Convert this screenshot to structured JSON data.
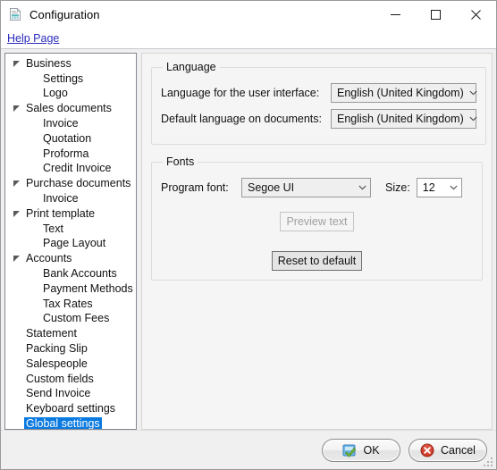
{
  "window": {
    "title": "Configuration",
    "icon": "document-icon",
    "minimize_label": "Minimize",
    "maximize_label": "Maximize",
    "close_label": "Close"
  },
  "menu": {
    "help_link": "Help Page"
  },
  "tree": {
    "selected": "Global settings",
    "items": [
      {
        "label": "Business",
        "level": 0,
        "expandable": true,
        "selected": false
      },
      {
        "label": "Settings",
        "level": 1,
        "expandable": false,
        "selected": false
      },
      {
        "label": "Logo",
        "level": 1,
        "expandable": false,
        "selected": false
      },
      {
        "label": "Sales documents",
        "level": 0,
        "expandable": true,
        "selected": false
      },
      {
        "label": "Invoice",
        "level": 1,
        "expandable": false,
        "selected": false
      },
      {
        "label": "Quotation",
        "level": 1,
        "expandable": false,
        "selected": false
      },
      {
        "label": "Proforma",
        "level": 1,
        "expandable": false,
        "selected": false
      },
      {
        "label": "Credit Invoice",
        "level": 1,
        "expandable": false,
        "selected": false
      },
      {
        "label": "Purchase documents",
        "level": 0,
        "expandable": true,
        "selected": false
      },
      {
        "label": "Invoice",
        "level": 1,
        "expandable": false,
        "selected": false
      },
      {
        "label": "Print template",
        "level": 0,
        "expandable": true,
        "selected": false
      },
      {
        "label": "Text",
        "level": 1,
        "expandable": false,
        "selected": false
      },
      {
        "label": "Page Layout",
        "level": 1,
        "expandable": false,
        "selected": false
      },
      {
        "label": "Accounts",
        "level": 0,
        "expandable": true,
        "selected": false
      },
      {
        "label": "Bank Accounts",
        "level": 1,
        "expandable": false,
        "selected": false
      },
      {
        "label": "Payment Methods",
        "level": 1,
        "expandable": false,
        "selected": false
      },
      {
        "label": "Tax Rates",
        "level": 1,
        "expandable": false,
        "selected": false
      },
      {
        "label": "Custom Fees",
        "level": 1,
        "expandable": false,
        "selected": false
      },
      {
        "label": "Statement",
        "level": 0,
        "expandable": false,
        "selected": false
      },
      {
        "label": "Packing Slip",
        "level": 0,
        "expandable": false,
        "selected": false
      },
      {
        "label": "Salespeople",
        "level": 0,
        "expandable": false,
        "selected": false
      },
      {
        "label": "Custom fields",
        "level": 0,
        "expandable": false,
        "selected": false
      },
      {
        "label": "Send Invoice",
        "level": 0,
        "expandable": false,
        "selected": false
      },
      {
        "label": "Keyboard settings",
        "level": 0,
        "expandable": false,
        "selected": false
      },
      {
        "label": "Global settings",
        "level": 0,
        "expandable": false,
        "selected": true
      }
    ]
  },
  "content": {
    "language_group": {
      "legend": "Language",
      "ui_language_label": "Language for the user interface:",
      "ui_language_value": "English (United Kingdom)",
      "doc_language_label": "Default language on documents:",
      "doc_language_value": "English (United Kingdom)"
    },
    "fonts_group": {
      "legend": "Fonts",
      "program_font_label": "Program font:",
      "program_font_value": "Segoe UI",
      "size_label": "Size:",
      "size_value": "12",
      "preview_button": "Preview text",
      "reset_button": "Reset to default"
    }
  },
  "footer": {
    "ok_label": "OK",
    "cancel_label": "Cancel",
    "ok_icon": "green-check-icon",
    "cancel_icon": "red-x-icon"
  },
  "colors": {
    "selection_blue": "#0a7ae0",
    "link_blue": "#2b2bbd",
    "ok_green": "#5aa832",
    "cancel_red": "#c1392b",
    "window_bg": "#f0f0f0"
  }
}
